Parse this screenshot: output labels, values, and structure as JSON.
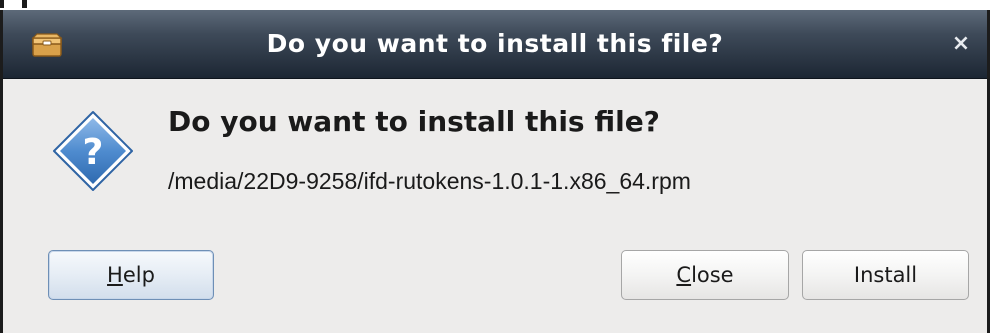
{
  "dialog": {
    "title": "Do you want to install this file?",
    "heading": "Do you want to install this file?",
    "file_path": "/media/22D9-9258/ifd-rutokens-1.0.1-1.x86_64.rpm",
    "close_glyph": "×"
  },
  "buttons": {
    "help": {
      "mnemonic": "H",
      "rest": "elp"
    },
    "close": {
      "mnemonic": "C",
      "rest": "lose"
    },
    "install": {
      "label": "Install"
    }
  },
  "icons": {
    "app": "package-icon",
    "dialog": "question-icon",
    "close": "close-icon"
  },
  "colors": {
    "titlebar_top": "#5d6a79",
    "titlebar_bottom": "#1c2633",
    "dialog_bg": "#edeceb",
    "question_diamond": "#3f7fc6",
    "help_button_border": "#6e8fb6"
  }
}
